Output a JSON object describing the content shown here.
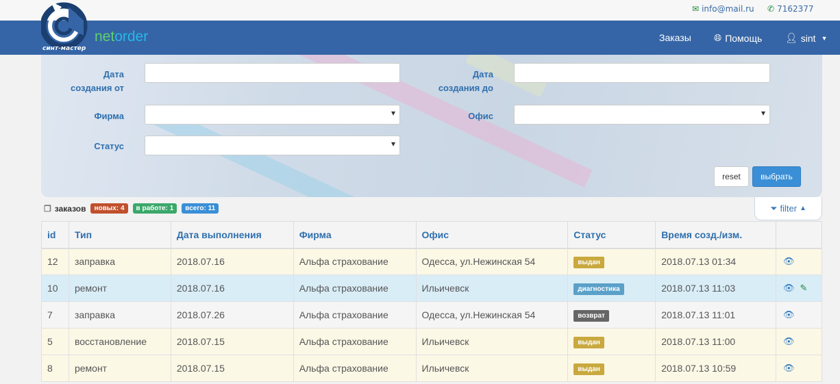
{
  "contacts": {
    "email": "info@mail.ru",
    "phone": "7162377"
  },
  "brand": {
    "part1": "net",
    "part2": "order",
    "logo_caption": "синт-мастер"
  },
  "nav": {
    "orders": "Заказы",
    "help": "Помощь",
    "user": "sint"
  },
  "filters": {
    "date_from_label_1": "Дата",
    "date_from_label_2": "создания от",
    "date_to_label_1": "Дата",
    "date_to_label_2": "создания до",
    "company_label": "Фирма",
    "office_label": "Офис",
    "status_label": "Статус",
    "reset": "reset",
    "select": "выбрать"
  },
  "summary": {
    "label": "заказов",
    "new": "новых: 4",
    "in_work": "в работе: 1",
    "total": "всего: 11",
    "filter": "filter"
  },
  "table": {
    "headers": [
      "id",
      "Тип",
      "Дата выполнения",
      "Фирма",
      "Офис",
      "Статус",
      "Время созд./изм."
    ],
    "rows": [
      {
        "id": "12",
        "type": "заправка",
        "due": "2018.07.16",
        "company": "Альфа страхование",
        "office": "Одесса, ул.Нежинская 54",
        "status": "выдан",
        "time": "2018.07.13 01:34"
      },
      {
        "id": "10",
        "type": "ремонт",
        "due": "2018.07.16",
        "company": "Альфа страхование",
        "office": "Ильичевск",
        "status": "диагностика",
        "time": "2018.07.13 11:03"
      },
      {
        "id": "7",
        "type": "заправка",
        "due": "2018.07.26",
        "company": "Альфа страхование",
        "office": "Одесса, ул.Нежинская 54",
        "status": "возврат",
        "time": "2018.07.13 11:01"
      },
      {
        "id": "5",
        "type": "восстановление",
        "due": "2018.07.15",
        "company": "Альфа страхование",
        "office": "Ильичевск",
        "status": "выдан",
        "time": "2018.07.13 11:00"
      },
      {
        "id": "8",
        "type": "ремонт",
        "due": "2018.07.15",
        "company": "Альфа страхование",
        "office": "Ильичевск",
        "status": "выдан",
        "time": "2018.07.13 10:59"
      }
    ]
  },
  "colors": {
    "navbar": "#3565a6",
    "status_issued": "#c9a93e",
    "status_diagnostics": "#5aa0c8",
    "status_return": "#666666"
  }
}
